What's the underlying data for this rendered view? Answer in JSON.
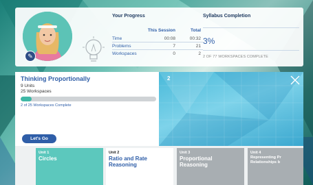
{
  "progress": {
    "section_title": "Your Progress",
    "col_session": "This Session",
    "col_total": "Total",
    "rows": [
      {
        "label": "Time",
        "session": "00:08",
        "total": "00:32"
      },
      {
        "label": "Problems",
        "session": "7",
        "total": "21"
      },
      {
        "label": "Workspaces",
        "session": "0",
        "total": "2"
      }
    ]
  },
  "syllabus": {
    "section_title": "Syllabus Completion",
    "percent": "3%",
    "complete_text": "2 OF 77 WORKSPACES COMPLETE"
  },
  "unit_card": {
    "title": "Thinking Proportionally",
    "units": "9 Units",
    "workspaces": "25 Workspaces",
    "progress_fraction": 0.08,
    "complete_text": "2 of 25 Workspaces Complete",
    "button_label": "Let's Go"
  },
  "preview": {
    "number": "2"
  },
  "tiles": [
    {
      "unit": "Unit 1",
      "name": "Circles"
    },
    {
      "unit": "Unit 2",
      "name": "Ratio and Rate Reasoning"
    },
    {
      "unit": "Unit 3",
      "name": "Proportional Reasoning"
    },
    {
      "unit": "Unit 4",
      "name": "Representing Pr Relationships b"
    }
  ],
  "colors": {
    "accent": "#2f5ea8",
    "teal": "#5cc8bd",
    "tile_gray": "#a8aeb2"
  },
  "icons": {
    "edit": "pencil-icon",
    "close": "close-icon",
    "decor": "lightbulb-icon"
  }
}
